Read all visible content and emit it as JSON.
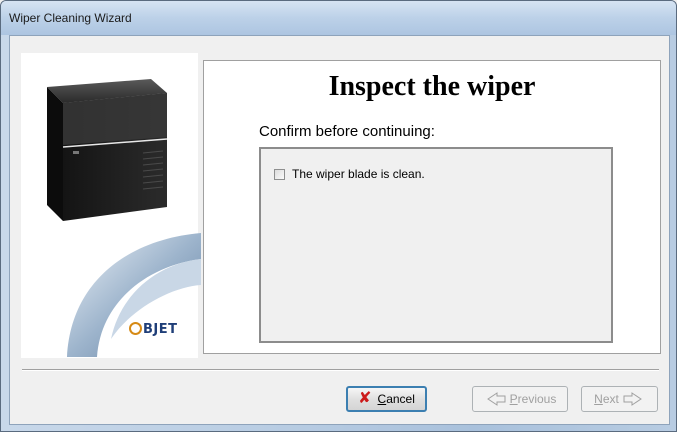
{
  "window": {
    "title": "Wiper Cleaning Wizard"
  },
  "branding": {
    "logo_text": "BJET",
    "logo_accent_color": "#d68a15",
    "logo_color": "#1f3e78"
  },
  "main": {
    "title": "Inspect the wiper",
    "confirm_label": "Confirm before continuing:",
    "checklist": [
      {
        "label": "The wiper blade is clean.",
        "checked": false
      }
    ]
  },
  "buttons": {
    "cancel": {
      "label": "Cancel",
      "icon": "red-x-icon"
    },
    "previous": {
      "label": "Previous",
      "icon": "left-arrow-icon",
      "enabled": false
    },
    "next": {
      "label": "Next",
      "icon": "right-arrow-icon",
      "enabled": false
    }
  }
}
